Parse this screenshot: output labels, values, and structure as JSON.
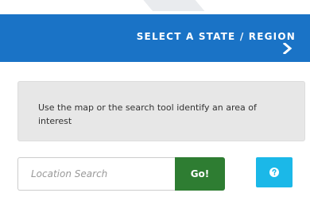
{
  "header": {
    "title": "SELECT A STATE / REGION",
    "chevron_icon": "chevron-right-icon",
    "background_color": "#1a73c6"
  },
  "info": {
    "text": "Use the map or the search tool identify an area of interest"
  },
  "search": {
    "placeholder": "Location Search",
    "value": "",
    "go_label": "Go!",
    "go_color": "#2e7d32"
  },
  "help": {
    "icon": "question-circle-icon",
    "color": "#1bb8e8"
  }
}
